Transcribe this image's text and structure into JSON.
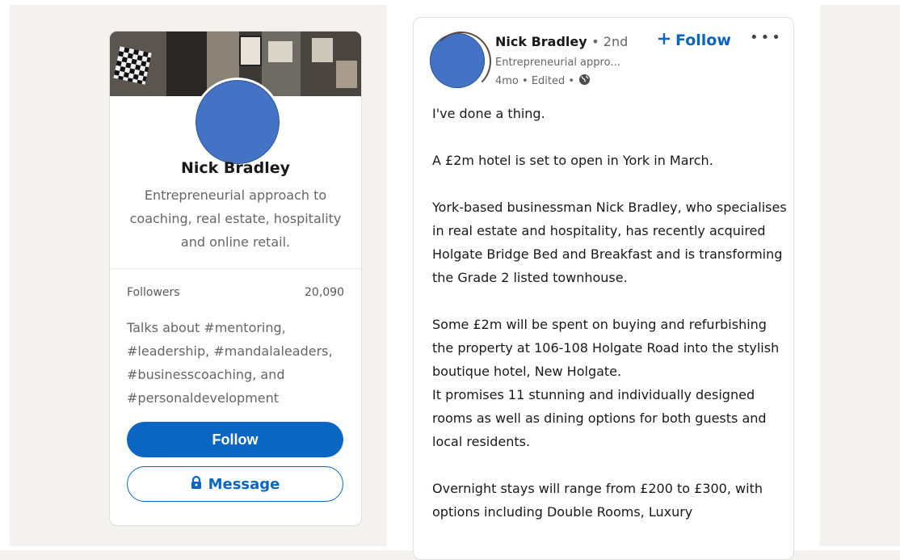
{
  "profile_card": {
    "name": "Nick Bradley",
    "headline": "Entrepreneurial approach to coaching, real estate, hospitality and online retail.",
    "followers_label": "Followers",
    "followers_count": "20,090",
    "talks_about": "Talks about #mentoring, #leadership, #mandalaleaders, #businesscoaching, and #personaldevelopment",
    "follow_button": "Follow",
    "message_button": "Message"
  },
  "post": {
    "author_name": "Nick Bradley",
    "degree": "• 2nd",
    "headline": "Entrepreneurial appro...",
    "meta": "4mo • Edited •",
    "follow_label": "Follow",
    "more_label": "•••",
    "paragraphs": [
      "I've done a thing.",
      "A £2m hotel is set to open in York in March.",
      "York-based businessman Nick Bradley, who specialises in real estate and hospitality, has recently acquired Holgate Bridge Bed and Breakfast and is transforming the Grade 2 listed townhouse.",
      "Some £2m will be spent on buying and refurbishing the property at 106-108 Holgate Road into the stylish boutique hotel, New Holgate.\nIt promises 11 stunning and individually designed rooms as well as dining options for both guests and local residents.",
      "Overnight stays will range from £200 to £300, with options including Double Rooms, Luxury"
    ]
  },
  "colors": {
    "brand": "#0a66c2",
    "avatar_fill": "#4472c4",
    "page_bg": "#f3f2ef"
  },
  "icons": {
    "lock": "lock-icon",
    "globe": "globe-icon",
    "plus": "plus-icon"
  }
}
